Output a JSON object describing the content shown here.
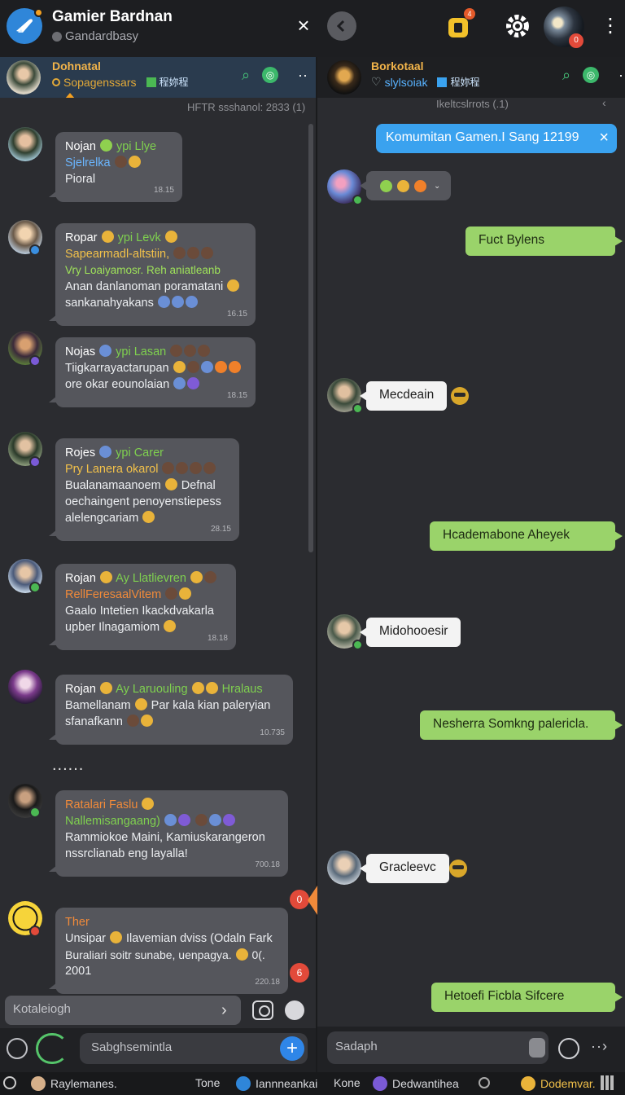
{
  "app": {
    "title": "Gamier Bardnan",
    "subtitle": "Gandardbasy",
    "lock_badge": "4",
    "profile_badge": "0"
  },
  "left_header": {
    "name": "Dohnatal",
    "sub": "Sopagenssars",
    "tag": "程妳程"
  },
  "right_header": {
    "name": "Borkotaal",
    "sub": "slylsoiak",
    "tag": "程妳程"
  },
  "left_meta": "HFTR ssshanol: 2833 (1)",
  "right_meta": "Ikeltcslrrots (.1)",
  "left_messages": [
    {
      "name": "Nojan",
      "tag": "ypi Llye",
      "lines": [
        "Sjelrelka",
        "Pioral"
      ],
      "time": "18.15"
    },
    {
      "name": "Ropar",
      "tag": "ypi Levk",
      "lines": [
        "Sapearmadl-altstiin,",
        "Vry Loaiyamosr. Reh aniatleanb",
        "Anan danlanoman poramatani",
        "sankanahyakans"
      ],
      "time": "16.15"
    },
    {
      "name": "Nojas",
      "tag": "ypi Lasan",
      "lines": [
        "Tiigkarrayactarupan",
        "ore okar eounolaian"
      ],
      "time": "18.15"
    },
    {
      "name": "Rojes",
      "tag": "ypi Carer",
      "lines": [
        "Pry Lanera okarol",
        "Bualanamaanoem",
        "oechaingent penoyenstiepess",
        "alelengcariam"
      ],
      "time": "28.15",
      "extra": "Defnal"
    },
    {
      "name": "Rojan",
      "tag": "Ay Llatlievren",
      "lines": [
        "RellFeresaalVitem",
        "Gaalo Intetien Ikackdvakarla",
        "upber Ilnagamiom"
      ],
      "time": "18.18"
    },
    {
      "name": "Rojan",
      "tag": "Ay Laruouling",
      "tag2": "Hralaus",
      "lines": [
        "Bamellanam",
        "sfanafkann"
      ],
      "time": "10.735",
      "extra": "Par kala  kian paleryian"
    },
    {
      "name": "Ratalari Faslu",
      "tag": "",
      "lines": [
        "Nallemisangaang)",
        "Rammiokoe Maini, Kamiuskarangeron",
        "nssrclianab eng layalla!"
      ],
      "time": "700.18"
    },
    {
      "name": "Ther",
      "tag": "",
      "lines": [
        "Unsipar",
        "Buraliari soitr sunabe, uenpagya.",
        "2001"
      ],
      "time": "220.18",
      "extra": "Ilavemian dviss (Odaln Fark",
      "extra2": "0(."
    }
  ],
  "typing": "......",
  "left_badges": [
    "0",
    "6"
  ],
  "left_input_placeholder": "Kotaleiogh",
  "left_compose_placeholder": "Sabghsemintla",
  "right_banner": "Komumitan Gamen.I Sang 12199",
  "right_messages": [
    {
      "dir": "out",
      "text": "Fuct Bylens"
    },
    {
      "dir": "in",
      "text": "Mecdeain"
    },
    {
      "dir": "out",
      "text": "Hcademabone Aheyek"
    },
    {
      "dir": "in",
      "text": "Midohooesir"
    },
    {
      "dir": "out",
      "text": "Nesherra Somkng palericla."
    },
    {
      "dir": "in",
      "text": "Gracleevc"
    },
    {
      "dir": "out",
      "text": "Hetoefi Ficbla Sifcere"
    }
  ],
  "right_compose_placeholder": "Sadaph",
  "tabs": [
    {
      "label": "Raylemanes."
    },
    {
      "label": "Tone"
    },
    {
      "label": "Iannneankai"
    },
    {
      "label": "Kone"
    },
    {
      "label": "Dedwantihea"
    },
    {
      "label": "Dodemvar."
    }
  ],
  "colors": {
    "accent_blue": "#3aa2ef",
    "outgoing_green": "#9ad36a",
    "incoming_white": "#f3f3f3",
    "name_gold": "#f2b44a",
    "badge_red": "#e24a3a"
  }
}
